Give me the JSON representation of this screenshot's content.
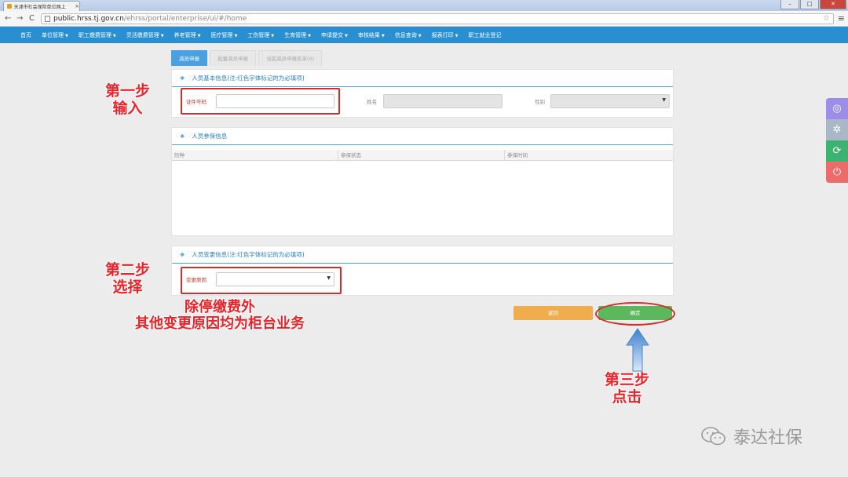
{
  "browser": {
    "tab_title": "天津市社会保险单位网上",
    "url_host": "public.hrss.tj.gov.cn",
    "url_path": "/ehrss/portal/enterprise/ui/#/home",
    "win_min": "–",
    "win_max": "□",
    "win_close": "✕"
  },
  "nav": {
    "items": [
      {
        "label": "首页",
        "caret": ""
      },
      {
        "label": "单位管理",
        "caret": "▼"
      },
      {
        "label": "职工缴费管理",
        "caret": "▼"
      },
      {
        "label": "灵活缴费管理",
        "caret": "▼"
      },
      {
        "label": "养老管理",
        "caret": "▼"
      },
      {
        "label": "医疗管理",
        "caret": "▼"
      },
      {
        "label": "工伤管理",
        "caret": "▼"
      },
      {
        "label": "生育管理",
        "caret": "▼"
      },
      {
        "label": "申请提交",
        "caret": "▼"
      },
      {
        "label": "审核结果",
        "caret": "▼"
      },
      {
        "label": "信息查询",
        "caret": "▼"
      },
      {
        "label": "报表打印",
        "caret": "▼"
      },
      {
        "label": "职工就业登记",
        "caret": ""
      }
    ]
  },
  "page_tabs": [
    {
      "label": "减员申报",
      "active": true
    },
    {
      "label": "批量减员申报",
      "active": false
    },
    {
      "label": "当前减员申报名单(0)",
      "active": false
    }
  ],
  "basic_panel": {
    "title": "人员基本信息(注:红色字体标记的为必填项)",
    "id_label": "证件号码",
    "id_value": "",
    "name_label": "姓名",
    "gender_label": "性别"
  },
  "insurance_panel": {
    "title": "人员参保信息",
    "columns": [
      "险种",
      "参保状态",
      "参保时间"
    ]
  },
  "change_panel": {
    "title": "人员变更信息(注:红色字体标记的为必填项)",
    "reason_label": "变更原因"
  },
  "buttons": {
    "back": "返回",
    "confirm": "确定"
  },
  "annotations": {
    "step1": [
      "第一步",
      "输入"
    ],
    "step2": [
      "第二步",
      "选择"
    ],
    "note": [
      "除停缴费外",
      "其他变更原因均为柜台业务"
    ],
    "step3": [
      "第三步",
      "点击"
    ]
  },
  "watermark": "泰达社保",
  "colors": {
    "nav": "#2a8fd1",
    "annotation": "#e8242a",
    "back": "#f0ad4e",
    "confirm": "#5cb85c"
  }
}
